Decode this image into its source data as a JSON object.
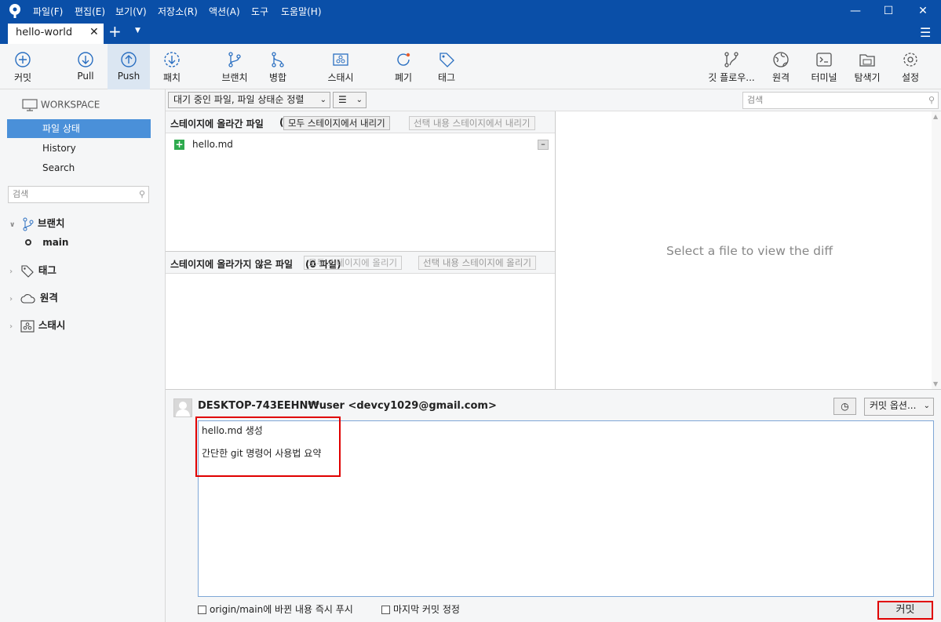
{
  "menu": [
    "파일(F)",
    "편집(E)",
    "보기(V)",
    "저장소(R)",
    "액션(A)",
    "도구",
    "도움말(H)"
  ],
  "tab": {
    "title": "hello-world"
  },
  "toolbar": {
    "commit": "커밋",
    "pull": "Pull",
    "push": "Push",
    "fetch": "패치",
    "branch": "브랜치",
    "merge": "병합",
    "stash": "스태시",
    "discard": "폐기",
    "tag": "태그",
    "gitflow": "깃 플로우...",
    "remote": "원격",
    "terminal": "터미널",
    "explorer": "탐색기",
    "settings": "설정"
  },
  "sidebar": {
    "workspace": "WORKSPACE",
    "file_status": "파일 상태",
    "history": "History",
    "search": "Search",
    "search_placeholder": "검색",
    "branches": "브랜치",
    "branch_main": "main",
    "tags": "태그",
    "remotes": "원격",
    "stashes": "스태시"
  },
  "filter": {
    "sort": "대기 중인 파일, 파일 상태순 정렬",
    "search_placeholder": "검색"
  },
  "staged": {
    "title": "스테이지에 올라간 파일",
    "paren": "(",
    "unstage_all": "모두 스테이지에서 내리기",
    "unstage_selected": "선택 내용 스테이지에서 내리기",
    "files": [
      {
        "name": "hello.md"
      }
    ]
  },
  "unstaged": {
    "title": "스테이지에 올라가지 않은 파일",
    "count": "(0 파일)",
    "stage_all": "모두 스테이지에 올리기",
    "stage_selected": "선택 내용 스테이지에 올리기"
  },
  "diff": {
    "placeholder": "Select a file to view the diff"
  },
  "commit": {
    "author": "DESKTOP-743EEHN₩user <devcy1029@gmail.com>",
    "options": "커밋 옵션...",
    "message_line1": "hello.md 생성",
    "message_line2": "간단한 git 명령어 사용법 요약",
    "push_immediately": "origin/main에 바뀐 내용 즉시 푸시",
    "amend": "마지막 커밋 정정",
    "commit_button": "커밋"
  },
  "colors": {
    "titlebar": "#0a4fa8",
    "selection": "#4a90d9",
    "highlight": "#e00000",
    "added": "#2eaa4e"
  }
}
